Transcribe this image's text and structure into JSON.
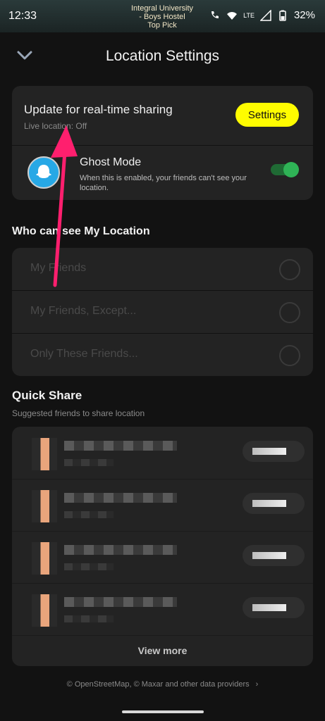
{
  "status": {
    "time": "12:33",
    "place": [
      "Integral University",
      "- Boys Hostel",
      "Top Pick"
    ],
    "network": "LTE",
    "battery": "32%"
  },
  "header": {
    "title": "Location Settings"
  },
  "realtime": {
    "heading": "Update for real-time sharing",
    "sub": "Live location: Off",
    "button": "Settings"
  },
  "ghost": {
    "title": "Ghost Mode",
    "desc": "When this is enabled, your friends can't see your location.",
    "enabled": true
  },
  "visibility": {
    "heading": "Who can see My Location",
    "options": [
      "My Friends",
      "My Friends, Except...",
      "Only These Friends..."
    ]
  },
  "quick_share": {
    "heading": "Quick Share",
    "sub": "Suggested friends to share location",
    "view_more": "View more"
  },
  "footer": {
    "attribution": "© OpenStreetMap, © Maxar and other data providers"
  },
  "colors": {
    "accent": "#fffc00",
    "toggle": "#2fb356",
    "annotation": "#ff1f6e"
  }
}
